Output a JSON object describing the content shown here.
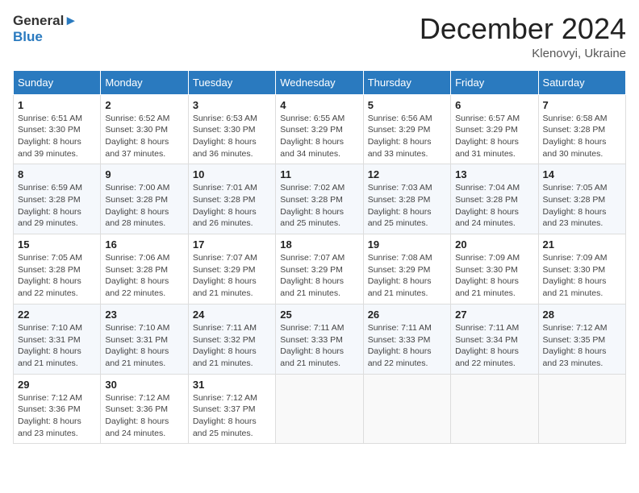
{
  "header": {
    "logo_general": "General",
    "logo_blue": "Blue",
    "month_title": "December 2024",
    "location": "Klenovyi, Ukraine"
  },
  "days_of_week": [
    "Sunday",
    "Monday",
    "Tuesday",
    "Wednesday",
    "Thursday",
    "Friday",
    "Saturday"
  ],
  "weeks": [
    [
      {
        "day": "1",
        "sunrise": "6:51 AM",
        "sunset": "3:30 PM",
        "daylight": "8 hours and 39 minutes."
      },
      {
        "day": "2",
        "sunrise": "6:52 AM",
        "sunset": "3:30 PM",
        "daylight": "8 hours and 37 minutes."
      },
      {
        "day": "3",
        "sunrise": "6:53 AM",
        "sunset": "3:30 PM",
        "daylight": "8 hours and 36 minutes."
      },
      {
        "day": "4",
        "sunrise": "6:55 AM",
        "sunset": "3:29 PM",
        "daylight": "8 hours and 34 minutes."
      },
      {
        "day": "5",
        "sunrise": "6:56 AM",
        "sunset": "3:29 PM",
        "daylight": "8 hours and 33 minutes."
      },
      {
        "day": "6",
        "sunrise": "6:57 AM",
        "sunset": "3:29 PM",
        "daylight": "8 hours and 31 minutes."
      },
      {
        "day": "7",
        "sunrise": "6:58 AM",
        "sunset": "3:28 PM",
        "daylight": "8 hours and 30 minutes."
      }
    ],
    [
      {
        "day": "8",
        "sunrise": "6:59 AM",
        "sunset": "3:28 PM",
        "daylight": "8 hours and 29 minutes."
      },
      {
        "day": "9",
        "sunrise": "7:00 AM",
        "sunset": "3:28 PM",
        "daylight": "8 hours and 28 minutes."
      },
      {
        "day": "10",
        "sunrise": "7:01 AM",
        "sunset": "3:28 PM",
        "daylight": "8 hours and 26 minutes."
      },
      {
        "day": "11",
        "sunrise": "7:02 AM",
        "sunset": "3:28 PM",
        "daylight": "8 hours and 25 minutes."
      },
      {
        "day": "12",
        "sunrise": "7:03 AM",
        "sunset": "3:28 PM",
        "daylight": "8 hours and 25 minutes."
      },
      {
        "day": "13",
        "sunrise": "7:04 AM",
        "sunset": "3:28 PM",
        "daylight": "8 hours and 24 minutes."
      },
      {
        "day": "14",
        "sunrise": "7:05 AM",
        "sunset": "3:28 PM",
        "daylight": "8 hours and 23 minutes."
      }
    ],
    [
      {
        "day": "15",
        "sunrise": "7:05 AM",
        "sunset": "3:28 PM",
        "daylight": "8 hours and 22 minutes."
      },
      {
        "day": "16",
        "sunrise": "7:06 AM",
        "sunset": "3:28 PM",
        "daylight": "8 hours and 22 minutes."
      },
      {
        "day": "17",
        "sunrise": "7:07 AM",
        "sunset": "3:29 PM",
        "daylight": "8 hours and 21 minutes."
      },
      {
        "day": "18",
        "sunrise": "7:07 AM",
        "sunset": "3:29 PM",
        "daylight": "8 hours and 21 minutes."
      },
      {
        "day": "19",
        "sunrise": "7:08 AM",
        "sunset": "3:29 PM",
        "daylight": "8 hours and 21 minutes."
      },
      {
        "day": "20",
        "sunrise": "7:09 AM",
        "sunset": "3:30 PM",
        "daylight": "8 hours and 21 minutes."
      },
      {
        "day": "21",
        "sunrise": "7:09 AM",
        "sunset": "3:30 PM",
        "daylight": "8 hours and 21 minutes."
      }
    ],
    [
      {
        "day": "22",
        "sunrise": "7:10 AM",
        "sunset": "3:31 PM",
        "daylight": "8 hours and 21 minutes."
      },
      {
        "day": "23",
        "sunrise": "7:10 AM",
        "sunset": "3:31 PM",
        "daylight": "8 hours and 21 minutes."
      },
      {
        "day": "24",
        "sunrise": "7:11 AM",
        "sunset": "3:32 PM",
        "daylight": "8 hours and 21 minutes."
      },
      {
        "day": "25",
        "sunrise": "7:11 AM",
        "sunset": "3:33 PM",
        "daylight": "8 hours and 21 minutes."
      },
      {
        "day": "26",
        "sunrise": "7:11 AM",
        "sunset": "3:33 PM",
        "daylight": "8 hours and 22 minutes."
      },
      {
        "day": "27",
        "sunrise": "7:11 AM",
        "sunset": "3:34 PM",
        "daylight": "8 hours and 22 minutes."
      },
      {
        "day": "28",
        "sunrise": "7:12 AM",
        "sunset": "3:35 PM",
        "daylight": "8 hours and 23 minutes."
      }
    ],
    [
      {
        "day": "29",
        "sunrise": "7:12 AM",
        "sunset": "3:36 PM",
        "daylight": "8 hours and 23 minutes."
      },
      {
        "day": "30",
        "sunrise": "7:12 AM",
        "sunset": "3:36 PM",
        "daylight": "8 hours and 24 minutes."
      },
      {
        "day": "31",
        "sunrise": "7:12 AM",
        "sunset": "3:37 PM",
        "daylight": "8 hours and 25 minutes."
      },
      null,
      null,
      null,
      null
    ]
  ]
}
